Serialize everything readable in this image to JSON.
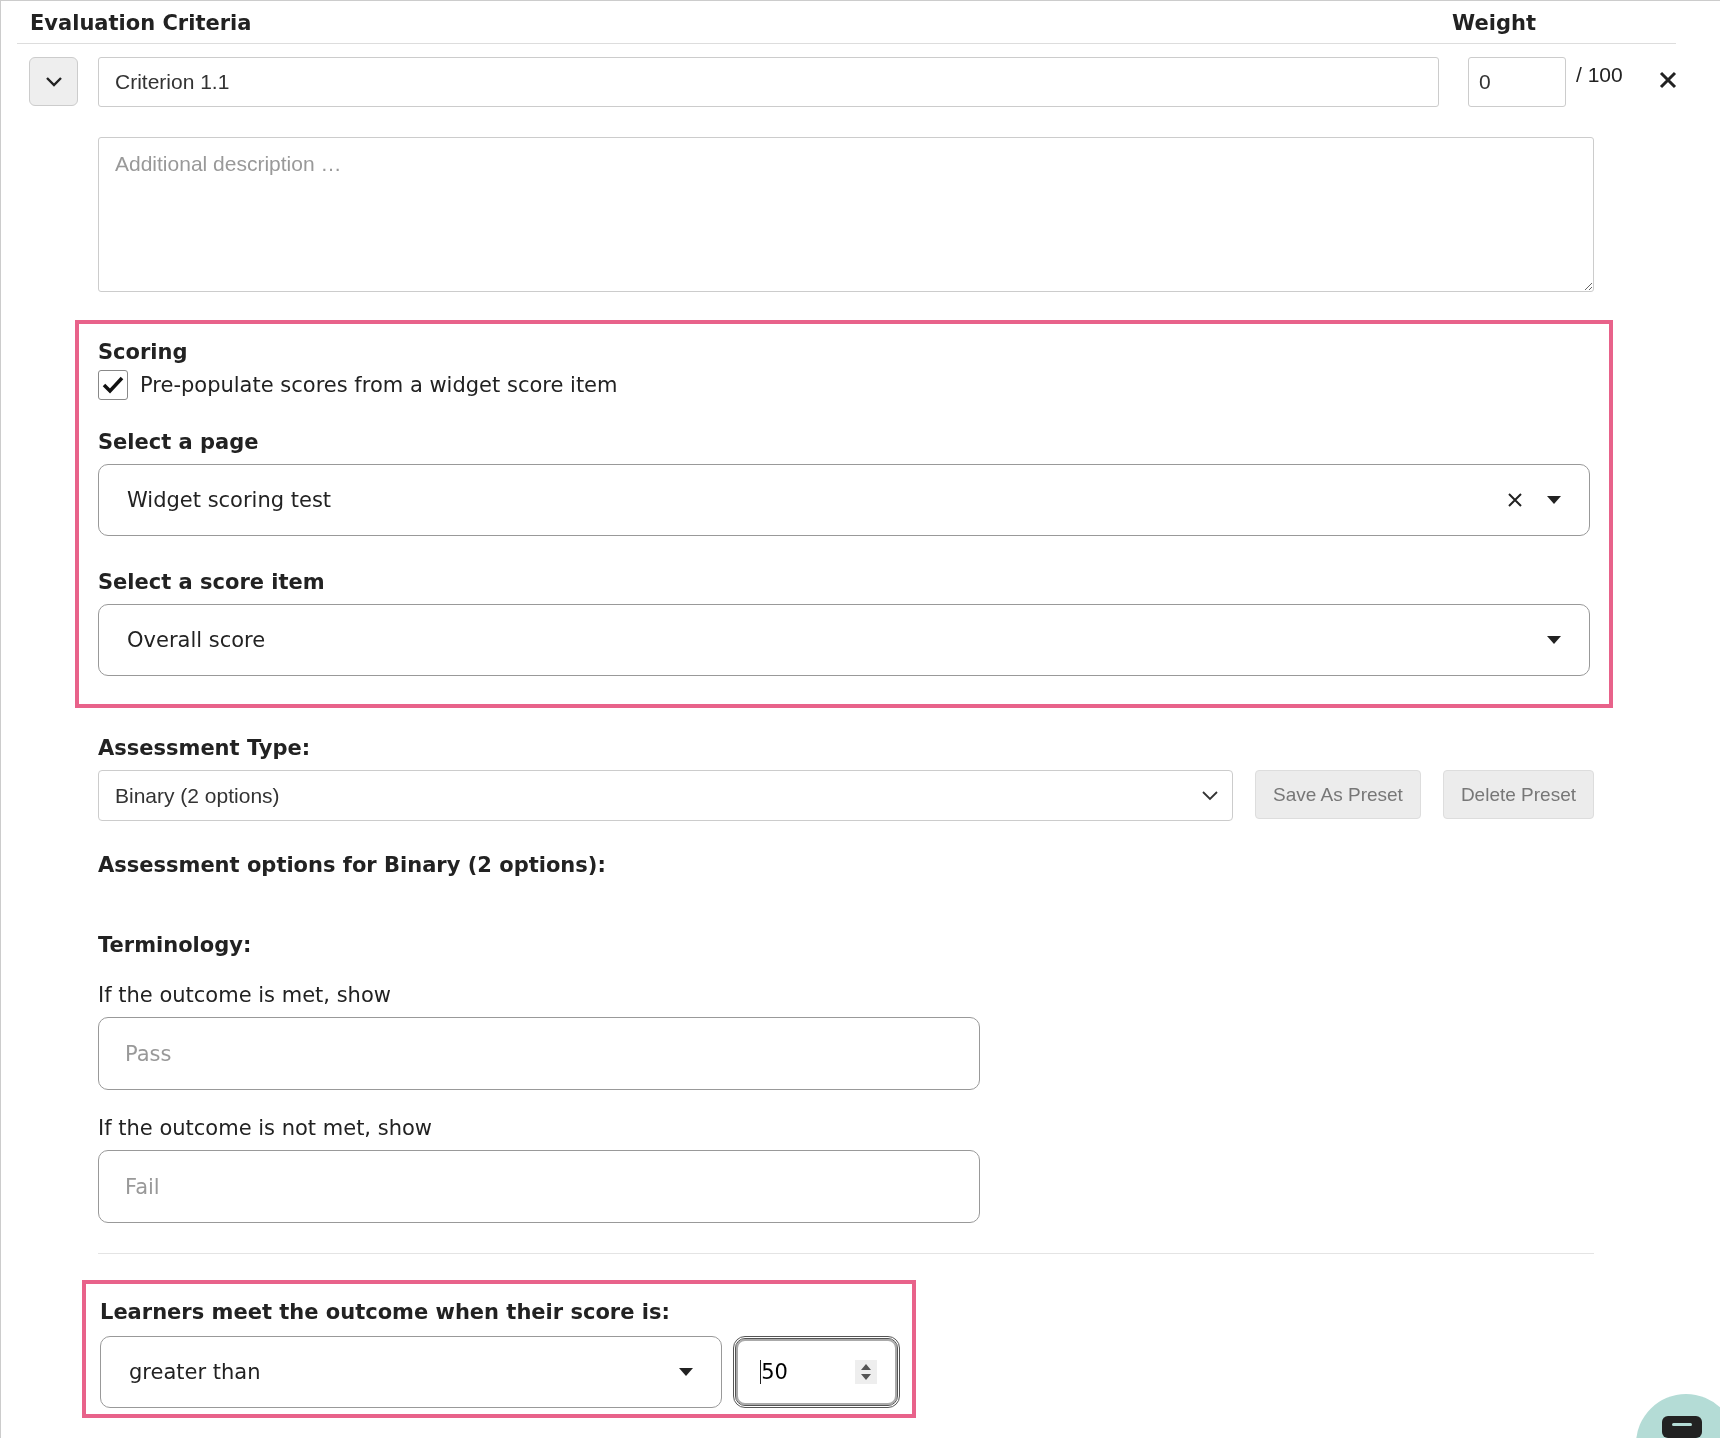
{
  "header": {
    "title": "Evaluation Criteria",
    "weight_label": "Weight"
  },
  "criterion": {
    "expanded": true,
    "name": "Criterion 1.1",
    "weight": "0",
    "weight_max": "/ 100",
    "description_placeholder": "Additional description …"
  },
  "scoring": {
    "title": "Scoring",
    "prepopulate": {
      "label": "Pre-populate scores from a widget score item",
      "checked": true
    },
    "page_select": {
      "label": "Select a page",
      "value": "Widget scoring test",
      "clearable": true
    },
    "score_item_select": {
      "label": "Select a score item",
      "value": "Overall score",
      "clearable": false
    }
  },
  "assessment": {
    "type_label": "Assessment Type:",
    "type_value": "Binary (2 options)",
    "buttons": [
      "Save As Preset",
      "Delete Preset"
    ],
    "options_title": "Assessment options for Binary (2 options):"
  },
  "terminology": {
    "title": "Terminology:",
    "fields": [
      {
        "label": "If the outcome is met, show",
        "placeholder": "Pass"
      },
      {
        "label": "If the outcome is not met, show",
        "placeholder": "Fail"
      }
    ]
  },
  "outcome": {
    "label": "Learners meet the outcome when their score is:",
    "comparison": "greater than",
    "score": "50"
  }
}
